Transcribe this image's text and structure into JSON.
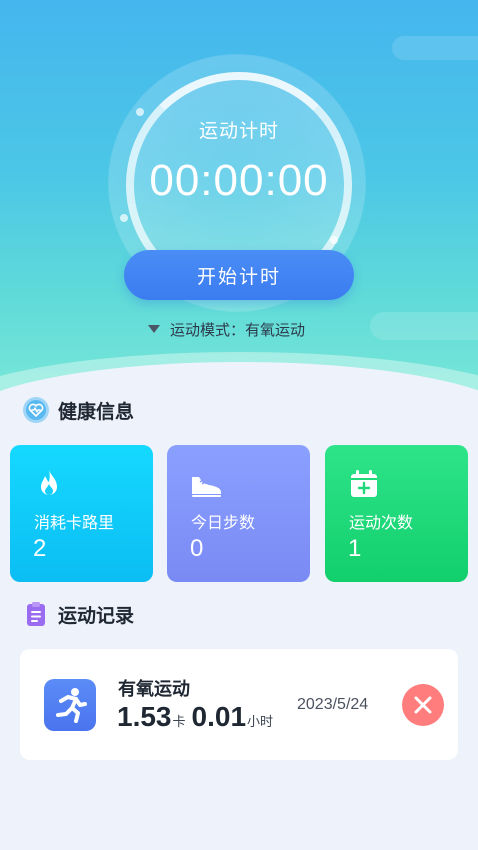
{
  "timer": {
    "label": "运动计时",
    "value": "00:00:00",
    "start_label": "开始计时",
    "mode_text": "运动模式：有氧运动"
  },
  "health": {
    "title": "健康信息",
    "cards": [
      {
        "label": "消耗卡路里",
        "value": "2",
        "icon": "fire-icon",
        "color": "#0bbdf3"
      },
      {
        "label": "今日步数",
        "value": "0",
        "icon": "shoe-icon",
        "color": "#7a8af4"
      },
      {
        "label": "运动次数",
        "value": "1",
        "icon": "calendar-icon",
        "color": "#12cf6c"
      }
    ]
  },
  "records": {
    "title": "运动记录",
    "items": [
      {
        "title": "有氧运动",
        "calories": "1.53",
        "calories_unit": "卡",
        "hours": "0.01",
        "hours_unit": "小时",
        "date": "2023/5/24"
      }
    ]
  },
  "colors": {
    "accent": "#3b7cf0",
    "delete": "#ff7d7d",
    "background": "#eef3fb"
  }
}
